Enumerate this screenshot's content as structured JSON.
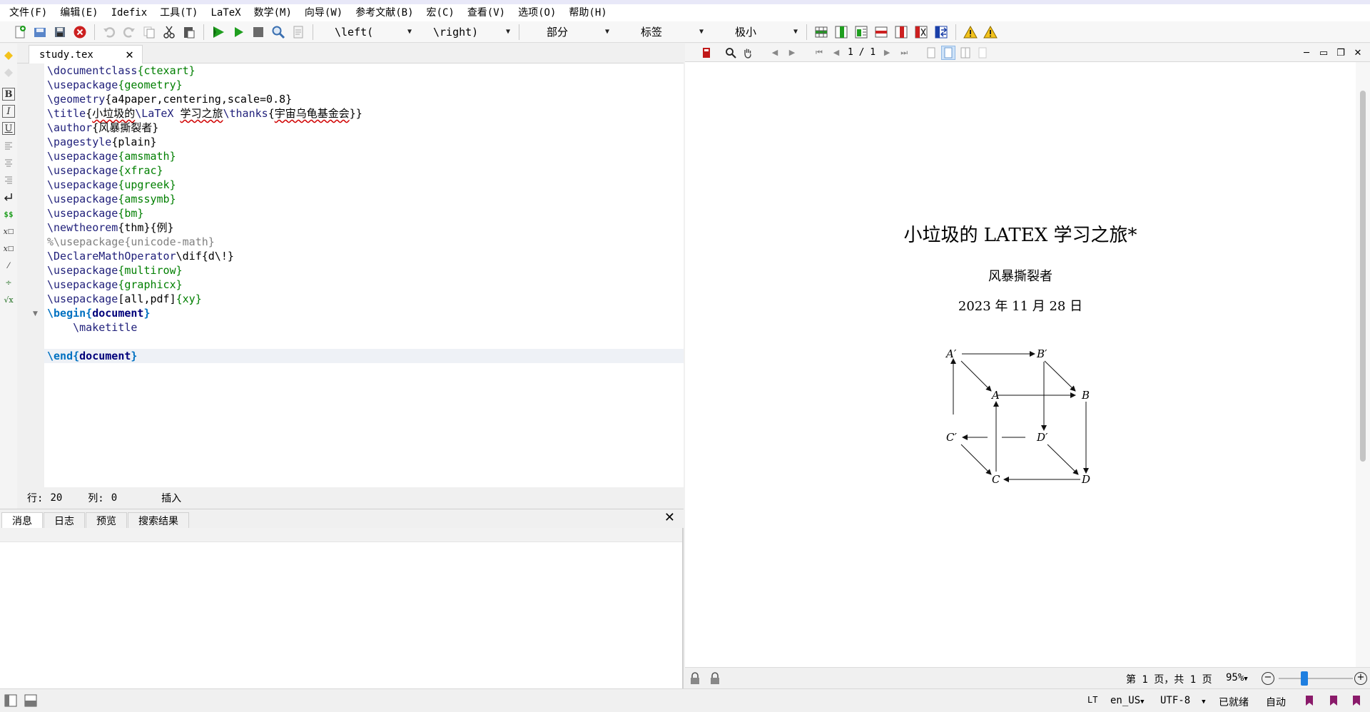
{
  "menu": [
    "文件(F)",
    "编辑(E)",
    "Idefix",
    "工具(T)",
    "LaTeX",
    "数学(M)",
    "向导(W)",
    "参考文献(B)",
    "宏(C)",
    "查看(V)",
    "选项(O)",
    "帮助(H)"
  ],
  "toolbar": {
    "combos": [
      "\\left(",
      "\\right)",
      "部分",
      "标签",
      "极小"
    ],
    "icons": [
      "new-file-icon",
      "save-all-icon",
      "save-icon",
      "close-file-icon",
      "undo-icon",
      "redo-icon",
      "copy-icon",
      "cut-icon",
      "paste-icon",
      "build-and-view-icon",
      "compile-icon",
      "stop-icon",
      "view-icon",
      "log-icon",
      "table-insert-row-icon",
      "table-insert-column-icon",
      "table-align-icon",
      "table-remove-row-icon",
      "table-remove-column-icon",
      "table-remove-cell-icon",
      "table-swap-icon",
      "warning-icon",
      "warning-alt-icon"
    ]
  },
  "editor": {
    "tab": "study.tex",
    "lines": [
      [
        [
          "cmd",
          "\\documentclass"
        ],
        [
          "arg",
          "{ctexart}"
        ]
      ],
      [
        [
          "cmd",
          "\\usepackage"
        ],
        [
          "arg",
          "{geometry}"
        ]
      ],
      [
        [
          "cmd",
          "\\geometry"
        ],
        [
          "plain",
          "{a4paper,centering,scale=0.8}"
        ]
      ],
      [
        [
          "cmd",
          "\\title"
        ],
        [
          "plain",
          "{"
        ],
        [
          "squig",
          "小垃圾的"
        ],
        [
          "cmd",
          "\\LaTeX "
        ],
        [
          "squig",
          "学习之旅"
        ],
        [
          "cmd",
          "\\thanks"
        ],
        [
          "plain",
          "{"
        ],
        [
          "squig",
          "宇宙乌龟基金会"
        ],
        [
          "plain",
          "}}"
        ]
      ],
      [
        [
          "cmd",
          "\\author"
        ],
        [
          "plain",
          "{风暴撕裂者}"
        ]
      ],
      [
        [
          "cmd",
          "\\pagestyle"
        ],
        [
          "plain",
          "{plain}"
        ]
      ],
      [
        [
          "cmd",
          "\\usepackage"
        ],
        [
          "arg",
          "{amsmath}"
        ]
      ],
      [
        [
          "cmd",
          "\\usepackage"
        ],
        [
          "arg",
          "{xfrac}"
        ]
      ],
      [
        [
          "cmd",
          "\\usepackage"
        ],
        [
          "arg",
          "{upgreek}"
        ]
      ],
      [
        [
          "cmd",
          "\\usepackage"
        ],
        [
          "arg",
          "{amssymb}"
        ]
      ],
      [
        [
          "cmd",
          "\\usepackage"
        ],
        [
          "arg",
          "{bm}"
        ]
      ],
      [
        [
          "cmd",
          "\\newtheorem"
        ],
        [
          "plain",
          "{thm}{例}"
        ]
      ],
      [
        [
          "cmt",
          "%\\usepackage{unicode-math}"
        ]
      ],
      [
        [
          "cmd",
          "\\DeclareMathOperator"
        ],
        [
          "plain",
          "\\dif{d\\!}"
        ]
      ],
      [
        [
          "cmd",
          "\\usepackage"
        ],
        [
          "arg",
          "{multirow}"
        ]
      ],
      [
        [
          "cmd",
          "\\usepackage"
        ],
        [
          "arg",
          "{graphicx}"
        ]
      ],
      [
        [
          "cmd",
          "\\usepackage"
        ],
        [
          "plain",
          "[all,pdf]"
        ],
        [
          "arg",
          "{xy}"
        ]
      ],
      [
        [
          "kw",
          "\\begin{"
        ],
        [
          "kwname",
          "document"
        ],
        [
          "kw",
          "}"
        ]
      ],
      [
        [
          "plain",
          "    "
        ],
        [
          "cmd",
          "\\maketitle"
        ]
      ],
      [
        [
          "plain",
          ""
        ]
      ],
      [
        [
          "kw",
          "\\end{"
        ],
        [
          "kwname",
          "document"
        ],
        [
          "kw",
          "}"
        ]
      ]
    ],
    "status": {
      "row_label": "行:",
      "row": "20",
      "col_label": "列:",
      "col": "0",
      "mode": "插入"
    }
  },
  "messages": {
    "tabs": [
      "消息",
      "日志",
      "预览",
      "搜索结果"
    ],
    "active": 0
  },
  "pdf": {
    "page_indicator": "1 / 1",
    "title": "小垃圾的 LATEX 学习之旅*",
    "author": "风暴撕裂者",
    "date": "2023 年 11 月 28 日",
    "cube_labels": {
      "A1": "A′",
      "B1": "B′",
      "A": "A",
      "B": "B",
      "C1": "C′",
      "D1": "D′",
      "C": "C",
      "D": "D"
    },
    "page_text": "第 1 页，共 1 页",
    "zoom": "95%",
    "zoom_level": 0.35
  },
  "statusbar": {
    "lang": "en_US",
    "encoding": "UTF-8",
    "ready": "已就绪",
    "auto": "自动"
  },
  "colors": {
    "green": "#1f9e1f",
    "blue": "#1f7fe0",
    "red": "#cc2020",
    "purple": "#8a1a6a"
  }
}
